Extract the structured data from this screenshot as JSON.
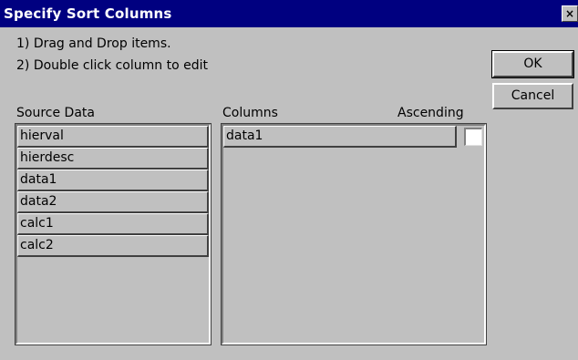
{
  "dialog": {
    "title": "Specify Sort Columns",
    "close_label": "×"
  },
  "instructions": [
    "1) Drag and Drop items.",
    "2) Double click column to edit"
  ],
  "buttons": {
    "ok": "OK",
    "cancel": "Cancel"
  },
  "source": {
    "label": "Source Data",
    "items": [
      "hierval",
      "hierdesc",
      "data1",
      "data2",
      "calc1",
      "calc2"
    ]
  },
  "columns": {
    "label": "Columns",
    "ascending_label": "Ascending",
    "rows": [
      {
        "name": "data1",
        "ascending": false
      }
    ]
  }
}
